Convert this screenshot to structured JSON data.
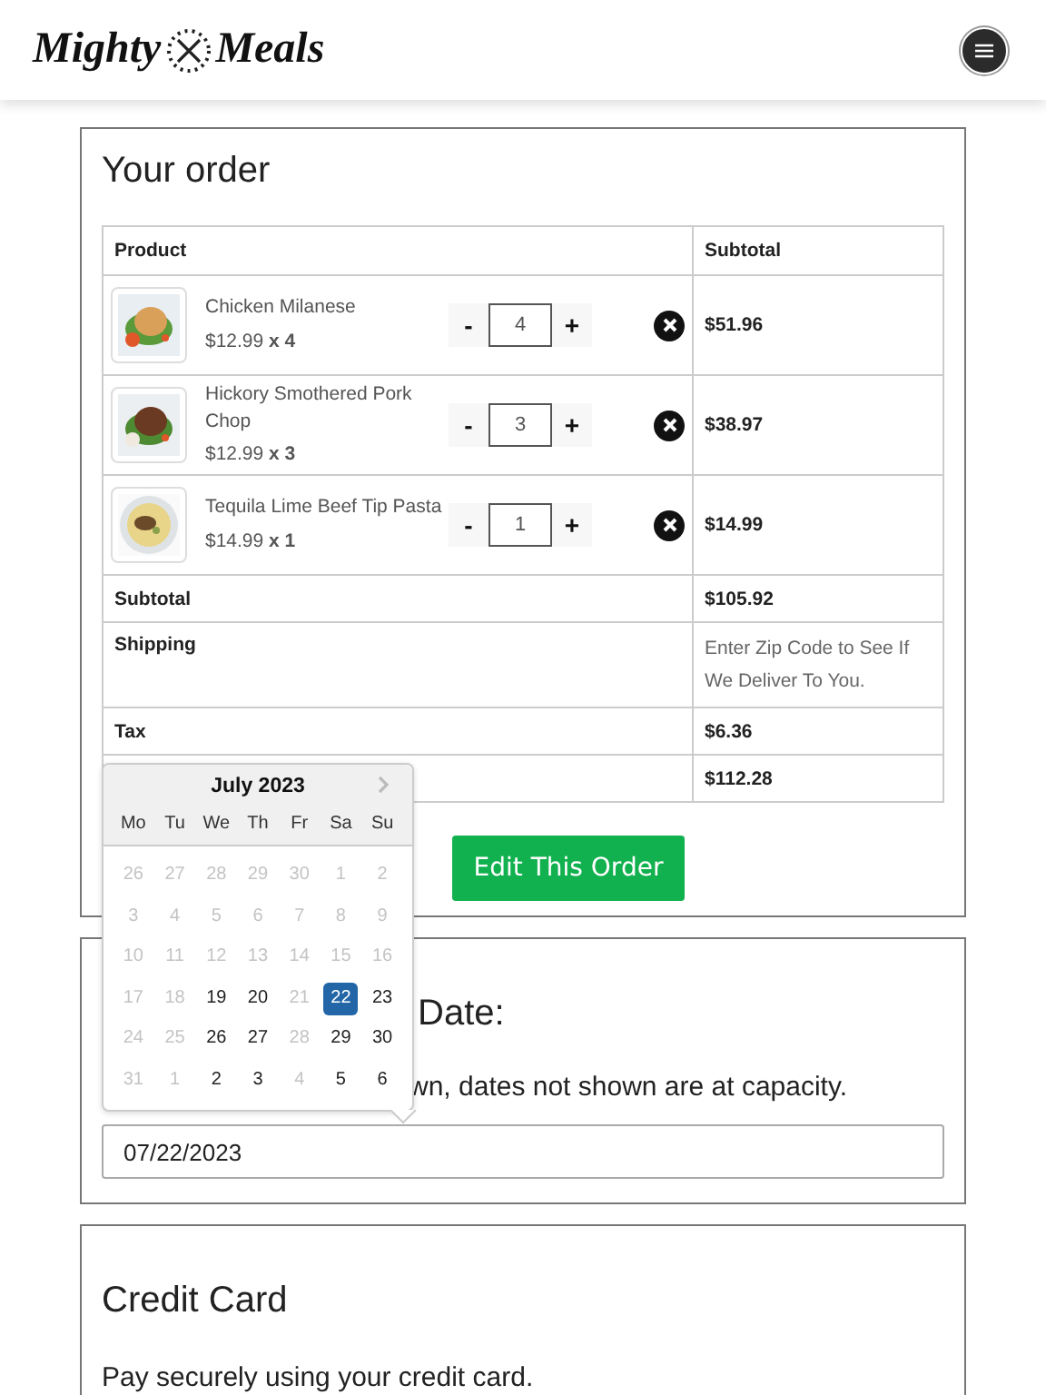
{
  "header": {
    "logo_left": "Mighty",
    "logo_right": "Meals"
  },
  "order": {
    "title": "Your order",
    "columns": [
      "Product",
      "Subtotal"
    ],
    "items": [
      {
        "name": "Chicken Milanese",
        "price": "$12.99",
        "qty_label": "x 4",
        "quantity": "4",
        "subtotal": "$51.96",
        "minus": "-",
        "plus": "+"
      },
      {
        "name": "Hickory Smothered Pork Chop",
        "price": "$12.99",
        "qty_label": "x 3",
        "quantity": "3",
        "subtotal": "$38.97",
        "minus": "-",
        "plus": "+"
      },
      {
        "name": "Tequila Lime Beef Tip Pasta",
        "price": "$14.99",
        "qty_label": "x 1",
        "quantity": "1",
        "subtotal": "$14.99",
        "minus": "-",
        "plus": "+"
      }
    ],
    "totals": [
      {
        "label": "Subtotal",
        "value": "$105.92",
        "kind": "bold"
      },
      {
        "label": "Shipping",
        "value": "Enter Zip Code to See If We Deliver To You.",
        "kind": "note"
      },
      {
        "label": "Tax",
        "value": "$6.36",
        "kind": "bold"
      },
      {
        "value": "$112.28",
        "kind": "bold"
      }
    ],
    "edit_button": "Edit This Order"
  },
  "delivery": {
    "title": "Date:",
    "note": "wn, dates not shown are at capacity.",
    "date_value": "07/22/2023"
  },
  "calendar": {
    "month": "July 2023",
    "weekdays": [
      "Mo",
      "Tu",
      "We",
      "Th",
      "Fr",
      "Sa",
      "Su"
    ],
    "days": [
      {
        "label": "26",
        "disabled": true,
        "selected": false
      },
      {
        "label": "27",
        "disabled": true,
        "selected": false
      },
      {
        "label": "28",
        "disabled": true,
        "selected": false
      },
      {
        "label": "29",
        "disabled": true,
        "selected": false
      },
      {
        "label": "30",
        "disabled": true,
        "selected": false
      },
      {
        "label": "1",
        "disabled": true,
        "selected": false
      },
      {
        "label": "2",
        "disabled": true,
        "selected": false
      },
      {
        "label": "3",
        "disabled": true,
        "selected": false
      },
      {
        "label": "4",
        "disabled": true,
        "selected": false
      },
      {
        "label": "5",
        "disabled": true,
        "selected": false
      },
      {
        "label": "6",
        "disabled": true,
        "selected": false
      },
      {
        "label": "7",
        "disabled": true,
        "selected": false
      },
      {
        "label": "8",
        "disabled": true,
        "selected": false
      },
      {
        "label": "9",
        "disabled": true,
        "selected": false
      },
      {
        "label": "10",
        "disabled": true,
        "selected": false
      },
      {
        "label": "11",
        "disabled": true,
        "selected": false
      },
      {
        "label": "12",
        "disabled": true,
        "selected": false
      },
      {
        "label": "13",
        "disabled": true,
        "selected": false
      },
      {
        "label": "14",
        "disabled": true,
        "selected": false
      },
      {
        "label": "15",
        "disabled": true,
        "selected": false
      },
      {
        "label": "16",
        "disabled": true,
        "selected": false
      },
      {
        "label": "17",
        "disabled": true,
        "selected": false
      },
      {
        "label": "18",
        "disabled": true,
        "selected": false
      },
      {
        "label": "19",
        "disabled": false,
        "selected": false
      },
      {
        "label": "20",
        "disabled": false,
        "selected": false
      },
      {
        "label": "21",
        "disabled": true,
        "selected": false
      },
      {
        "label": "22",
        "disabled": false,
        "selected": true
      },
      {
        "label": "23",
        "disabled": false,
        "selected": false
      },
      {
        "label": "24",
        "disabled": true,
        "selected": false
      },
      {
        "label": "25",
        "disabled": true,
        "selected": false
      },
      {
        "label": "26",
        "disabled": false,
        "selected": false
      },
      {
        "label": "27",
        "disabled": false,
        "selected": false
      },
      {
        "label": "28",
        "disabled": true,
        "selected": false
      },
      {
        "label": "29",
        "disabled": false,
        "selected": false
      },
      {
        "label": "30",
        "disabled": false,
        "selected": false
      },
      {
        "label": "31",
        "disabled": true,
        "selected": false
      },
      {
        "label": "1",
        "disabled": true,
        "selected": false
      },
      {
        "label": "2",
        "disabled": false,
        "selected": false
      },
      {
        "label": "3",
        "disabled": false,
        "selected": false
      },
      {
        "label": "4",
        "disabled": true,
        "selected": false
      },
      {
        "label": "5",
        "disabled": false,
        "selected": false
      },
      {
        "label": "6",
        "disabled": false,
        "selected": false
      }
    ]
  },
  "payment": {
    "title": "Credit Card",
    "note": "Pay securely using your credit card."
  }
}
